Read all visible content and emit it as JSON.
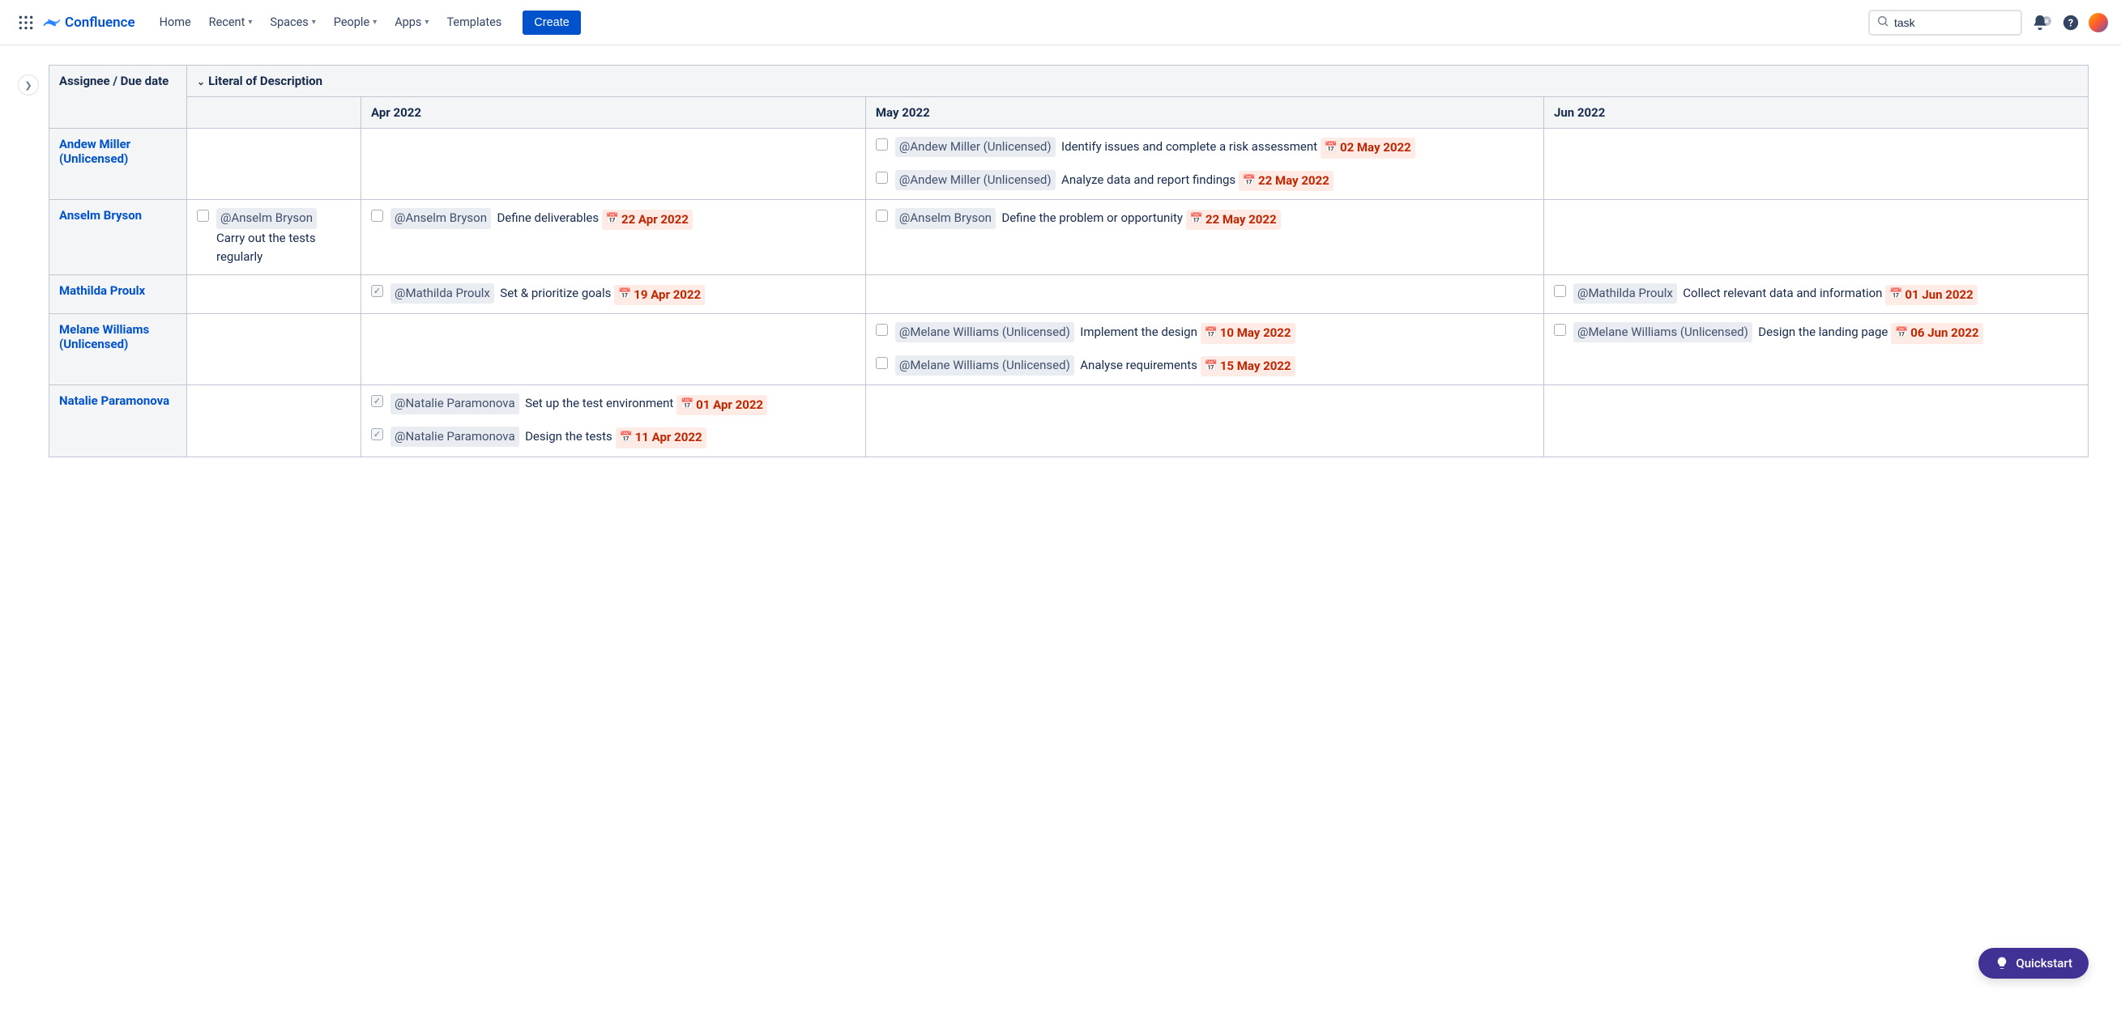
{
  "nav": {
    "product": "Confluence",
    "links": {
      "home": "Home",
      "recent": "Recent",
      "spaces": "Spaces",
      "people": "People",
      "apps": "Apps",
      "templates": "Templates"
    },
    "create": "Create",
    "search_value": "task"
  },
  "quickstart": "Quickstart",
  "table": {
    "header_assignee": "Assignee / Due date",
    "header_desc": "Literal of Description",
    "months": [
      "",
      "Apr 2022",
      "May 2022",
      "Jun 2022"
    ],
    "rows": [
      {
        "assignee": "Andew Miller (Unlicensed)",
        "cells": [
          [],
          [],
          [
            {
              "checked": false,
              "mention": "@Andew Miller (Unlicensed)",
              "text": "Identify issues and complete a risk assessment",
              "date": "02 May 2022"
            },
            {
              "checked": false,
              "mention": "@Andew Miller (Unlicensed)",
              "text": "Analyze data and report findings",
              "date": "22 May 2022"
            }
          ],
          []
        ]
      },
      {
        "assignee": "Anselm Bryson",
        "cells": [
          [
            {
              "checked": false,
              "mention": "@Anselm Bryson",
              "text": "Carry out the tests regularly",
              "date": ""
            }
          ],
          [
            {
              "checked": false,
              "mention": "@Anselm Bryson",
              "text": "Define deliverables",
              "date": "22 Apr 2022"
            }
          ],
          [
            {
              "checked": false,
              "mention": "@Anselm Bryson",
              "text": "Define the problem or opportunity",
              "date": "22 May 2022"
            }
          ],
          []
        ]
      },
      {
        "assignee": "Mathilda Proulx",
        "cells": [
          [],
          [
            {
              "checked": true,
              "mention": "@Mathilda Proulx",
              "text": "Set & prioritize goals",
              "date": "19 Apr 2022"
            }
          ],
          [],
          [
            {
              "checked": false,
              "mention": "@Mathilda Proulx",
              "text": "Collect relevant data and information",
              "date": "01 Jun 2022"
            }
          ]
        ]
      },
      {
        "assignee": "Melane Williams (Unlicensed)",
        "cells": [
          [],
          [],
          [
            {
              "checked": false,
              "mention": "@Melane Williams (Unlicensed)",
              "text": "Implement the design",
              "date": "10 May 2022"
            },
            {
              "checked": false,
              "mention": "@Melane Williams (Unlicensed)",
              "text": "Analyse requirements",
              "date": "15 May 2022"
            }
          ],
          [
            {
              "checked": false,
              "mention": "@Melane Williams (Unlicensed)",
              "text": "Design the landing page",
              "date": "06 Jun 2022"
            }
          ]
        ]
      },
      {
        "assignee": "Natalie Paramonova",
        "cells": [
          [],
          [
            {
              "checked": true,
              "mention": "@Natalie Paramonova",
              "text": "Set up the test environment",
              "date": "01 Apr 2022"
            },
            {
              "checked": true,
              "mention": "@Natalie Paramonova",
              "text": "Design the tests",
              "date": "11 Apr 2022"
            }
          ],
          [],
          []
        ]
      }
    ]
  }
}
